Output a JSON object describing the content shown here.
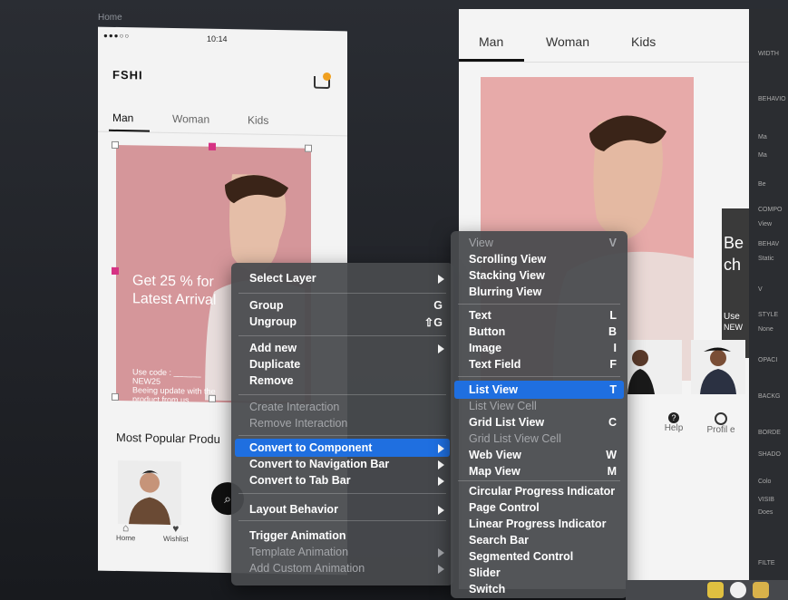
{
  "artboard": {
    "title": "Home"
  },
  "phone_left": {
    "status_time": "10:14",
    "status_dots": "●●●○○",
    "logo": "FSHI",
    "tabs": [
      "Man",
      "Woman",
      "Kids"
    ],
    "promo_line1": "Get 25 % for",
    "promo_line2": "Latest Arrival",
    "promo_code_line1": "Use code : ______",
    "promo_code_line2": "NEW25",
    "promo_code_line3": "Beeing update with the",
    "promo_code_line4": "product from us",
    "section_title": "Most Popular Produ",
    "nav_home": "Home",
    "nav_wishlist": "Wishlist"
  },
  "phone_right": {
    "tabs": [
      "Man",
      "Woman",
      "Kids"
    ],
    "strip_text_1": "Be",
    "strip_text_2": "ch",
    "strip_small_1": "Use",
    "strip_small_2": "NEW",
    "nav_help": "Help",
    "nav_profile": "Profil e"
  },
  "context_menu": {
    "items": [
      {
        "label": "Select Layer",
        "shortcut": "",
        "submenu": true,
        "disabled": false
      },
      {
        "label": "Group",
        "shortcut": "G",
        "submenu": false,
        "disabled": false
      },
      {
        "label": "Ungroup",
        "shortcut": "⇧G",
        "submenu": false,
        "disabled": false
      },
      {
        "label": "Add new",
        "shortcut": "",
        "submenu": true,
        "disabled": false
      },
      {
        "label": "Duplicate",
        "shortcut": "",
        "submenu": false,
        "disabled": false
      },
      {
        "label": "Remove",
        "shortcut": "",
        "submenu": false,
        "disabled": false
      },
      {
        "label": "Create Interaction",
        "shortcut": "",
        "submenu": false,
        "disabled": true
      },
      {
        "label": "Remove Interaction",
        "shortcut": "",
        "submenu": false,
        "disabled": true
      },
      {
        "label": "Convert to Component",
        "shortcut": "",
        "submenu": true,
        "disabled": false,
        "highlighted": true
      },
      {
        "label": "Convert to Navigation Bar",
        "shortcut": "",
        "submenu": true,
        "disabled": false
      },
      {
        "label": "Convert to Tab Bar",
        "shortcut": "",
        "submenu": true,
        "disabled": false
      },
      {
        "label": "Layout Behavior",
        "shortcut": "",
        "submenu": true,
        "disabled": false
      },
      {
        "label": "Trigger Animation",
        "shortcut": "",
        "submenu": false,
        "disabled": false
      },
      {
        "label": "Template Animation",
        "shortcut": "",
        "submenu": true,
        "disabled": true
      },
      {
        "label": "Add Custom Animation",
        "shortcut": "",
        "submenu": true,
        "disabled": true
      }
    ]
  },
  "component_submenu": {
    "items": [
      {
        "label": "View",
        "shortcut": "V",
        "disabled": true
      },
      {
        "label": "Scrolling View",
        "shortcut": "",
        "disabled": false
      },
      {
        "label": "Stacking View",
        "shortcut": "",
        "disabled": false
      },
      {
        "label": "Blurring View",
        "shortcut": "",
        "disabled": false
      },
      {
        "label": "Text",
        "shortcut": "L",
        "disabled": false
      },
      {
        "label": "Button",
        "shortcut": "B",
        "disabled": false
      },
      {
        "label": "Image",
        "shortcut": "I",
        "disabled": false
      },
      {
        "label": "Text Field",
        "shortcut": "F",
        "disabled": false
      },
      {
        "label": "List View",
        "shortcut": "T",
        "disabled": false,
        "highlighted": true
      },
      {
        "label": "List View Cell",
        "shortcut": "",
        "disabled": true
      },
      {
        "label": "Grid List View",
        "shortcut": "C",
        "disabled": false
      },
      {
        "label": "Grid List View Cell",
        "shortcut": "",
        "disabled": true
      },
      {
        "label": "Web View",
        "shortcut": "W",
        "disabled": false
      },
      {
        "label": "Map View",
        "shortcut": "M",
        "disabled": false
      },
      {
        "label": "Circular Progress Indicator",
        "shortcut": "",
        "disabled": false
      },
      {
        "label": "Page Control",
        "shortcut": "",
        "disabled": false
      },
      {
        "label": "Linear Progress Indicator",
        "shortcut": "",
        "disabled": false
      },
      {
        "label": "Search Bar",
        "shortcut": "",
        "disabled": false
      },
      {
        "label": "Segmented Control",
        "shortcut": "",
        "disabled": false
      },
      {
        "label": "Slider",
        "shortcut": "",
        "disabled": false
      },
      {
        "label": "Switch",
        "shortcut": "",
        "disabled": false
      }
    ]
  },
  "inspector": {
    "labels": [
      "WIDTH",
      "BEHAVIO",
      "Ma",
      "Ma",
      "Be",
      "COMPO",
      "View",
      "BEHAV",
      "Static",
      "V",
      "STYLE",
      "None",
      "OPACI",
      "BACKG",
      "BORDE",
      "SHADO",
      "Colo",
      "VISIB",
      "Does",
      "FILTE"
    ]
  },
  "colors": {
    "highlight": "#1f6fe0",
    "menu_bg": "#484a4e",
    "hero_pink": "#d5969a"
  }
}
